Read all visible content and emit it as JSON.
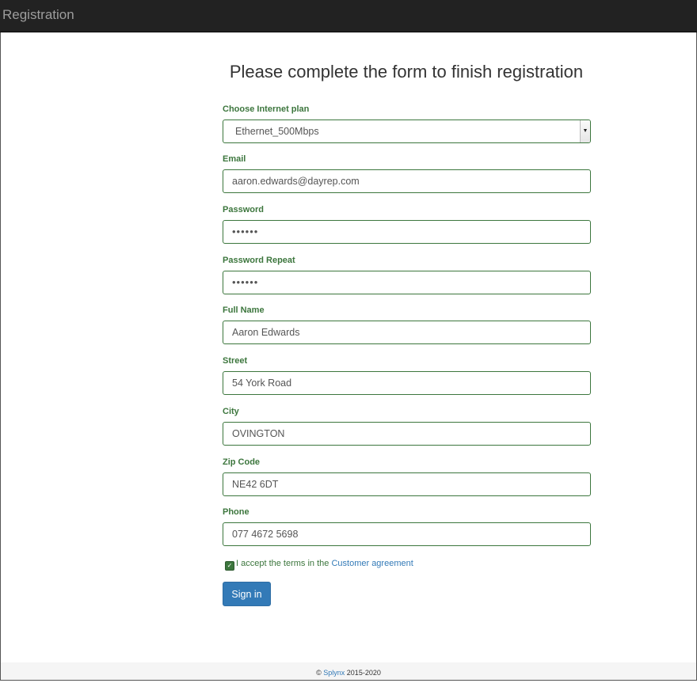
{
  "app": {
    "title": "Registration"
  },
  "page": {
    "heading": "Please complete the form to finish registration"
  },
  "form": {
    "plan": {
      "label": "Choose Internet plan",
      "value": "Ethernet_500Mbps"
    },
    "email": {
      "label": "Email",
      "value": "aaron.edwards@dayrep.com"
    },
    "password": {
      "label": "Password",
      "value": "••••••"
    },
    "password_repeat": {
      "label": "Password Repeat",
      "value": "••••••"
    },
    "full_name": {
      "label": "Full Name",
      "value": "Aaron Edwards"
    },
    "street": {
      "label": "Street",
      "value": "54 York Road"
    },
    "city": {
      "label": "City",
      "value": "OVINGTON"
    },
    "zip": {
      "label": "Zip Code",
      "value": "NE42 6DT"
    },
    "phone": {
      "label": "Phone",
      "value": "077 4672 5698"
    }
  },
  "terms": {
    "text": "I accept the terms in the ",
    "link": "Customer agreement",
    "checked": true
  },
  "submit_label": "Sign in",
  "footer": {
    "prefix": "© ",
    "link": "Splynx",
    "suffix": " 2015-2020"
  },
  "colors": {
    "accent": "#3c763d",
    "primary": "#337ab7",
    "navbar": "#222222"
  }
}
